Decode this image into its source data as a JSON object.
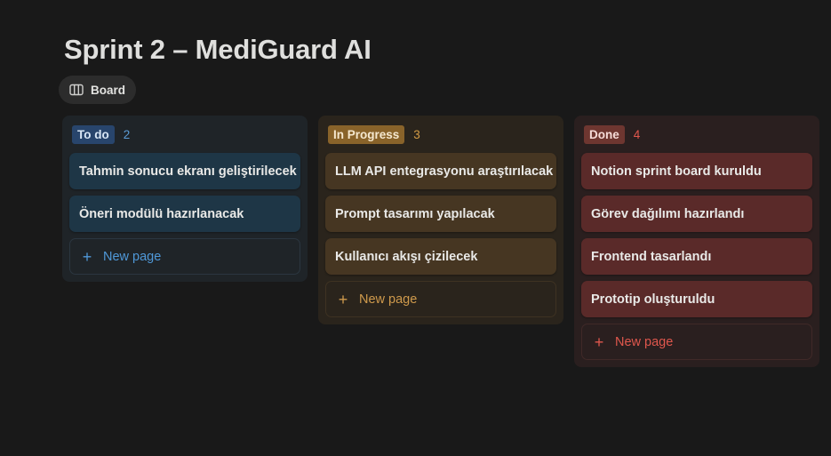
{
  "page": {
    "title": "Sprint 2 – MediGuard AI"
  },
  "view": {
    "label": "Board",
    "icon": "board-columns-icon"
  },
  "columns": [
    {
      "name": "To do",
      "count": "2",
      "color": "#5b9bd5",
      "cards": [
        "Tahmin sonucu ekranı geliştirilecek",
        "Öneri modülü hazırlanacak"
      ],
      "new_page_label": "New page"
    },
    {
      "name": "In Progress",
      "count": "3",
      "color": "#d39b45",
      "cards": [
        "LLM API entegrasyonu araştırılacak",
        "Prompt tasarımı yapılacak",
        "Kullanıcı akışı çizilecek"
      ],
      "new_page_label": "New page"
    },
    {
      "name": "Done",
      "count": "4",
      "color": "#e0574d",
      "cards": [
        "Notion sprint board kuruldu",
        "Görev dağılımı hazırlandı",
        "Frontend tasarlandı",
        "Prototip oluşturuldu"
      ],
      "new_page_label": "New page"
    }
  ]
}
